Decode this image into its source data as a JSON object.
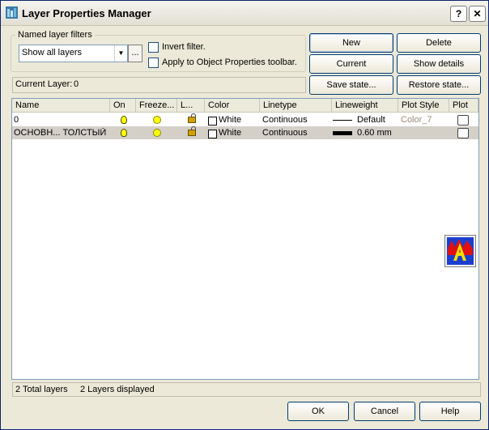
{
  "window": {
    "title": "Layer Properties Manager",
    "help_btn": "?",
    "close_btn": "✕"
  },
  "filters": {
    "group_label": "Named layer filters",
    "selected": "Show all layers",
    "ellipsis": "...",
    "invert_label": "Invert filter.",
    "invert_checked": false,
    "apply_label": "Apply to Object Properties toolbar.",
    "apply_checked": false
  },
  "buttons": {
    "new": "New",
    "delete": "Delete",
    "current": "Current",
    "show_details": "Show details",
    "save_state": "Save state...",
    "restore_state": "Restore state..."
  },
  "current_layer": {
    "label": "Current Layer:",
    "value": "0"
  },
  "table": {
    "columns": [
      "Name",
      "On",
      "Freeze...",
      "L...",
      "Color",
      "Linetype",
      "Lineweight",
      "Plot Style",
      "Plot"
    ],
    "rows": [
      {
        "name": "0",
        "on": "on",
        "freeze": "thawed",
        "lock": "unlocked",
        "color_swatch": "#ffffff",
        "color": "White",
        "linetype": "Continuous",
        "lineweight": "Default",
        "lineweight_style": "thin",
        "plot_style": "Color_7",
        "plot": "printer",
        "selected": false
      },
      {
        "name": "ОСНОВН... ТОЛСТЫЙ",
        "on": "on",
        "freeze": "thawed",
        "lock": "unlocked",
        "color_swatch": "#ffffff",
        "color": "White",
        "linetype": "Continuous",
        "lineweight": "0.60 mm",
        "lineweight_style": "thick",
        "plot_style": "",
        "plot": "printer",
        "selected": true
      }
    ]
  },
  "status": {
    "total": "2 Total layers",
    "displayed": "2 Layers displayed"
  },
  "footer": {
    "ok": "OK",
    "cancel": "Cancel",
    "help": "Help"
  },
  "colors": {
    "selection": "#d4d0c8",
    "plot_style_text": "#a08c78"
  }
}
